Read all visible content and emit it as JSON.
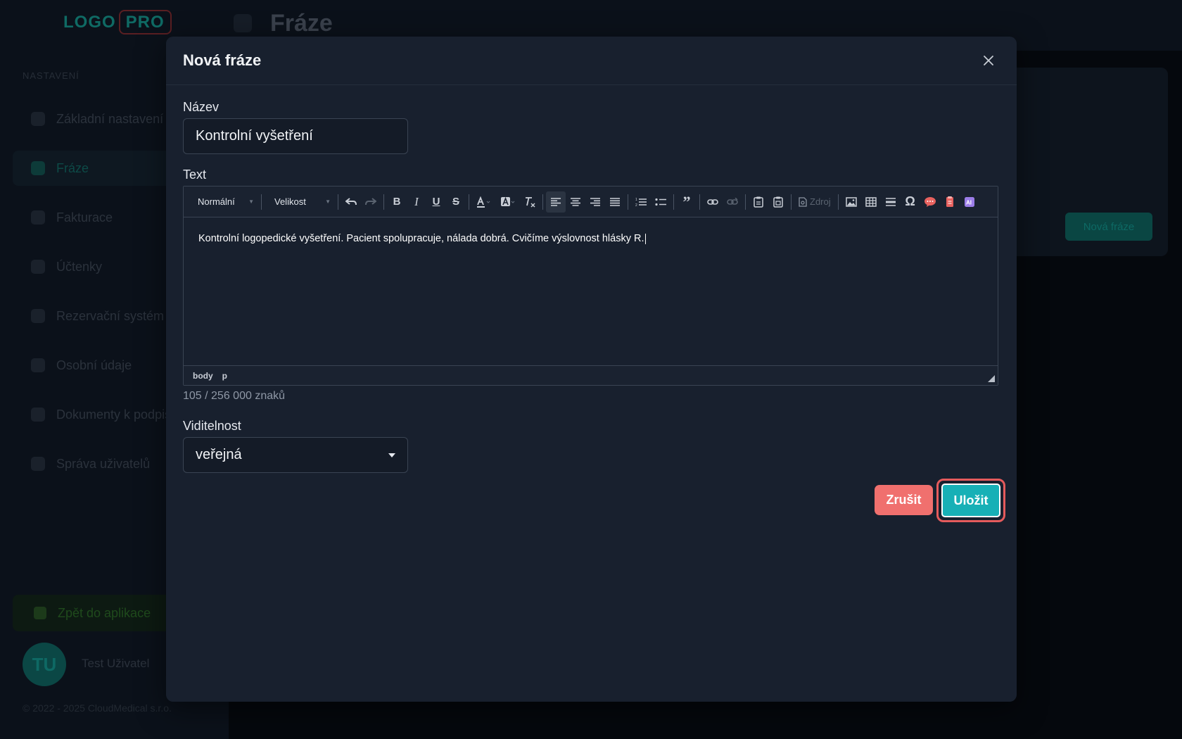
{
  "background": {
    "page_title": "Fráze",
    "logo_part1": "LOGO",
    "logo_part2": "PRO",
    "section_label": "NASTAVENÍ",
    "nav_items": [
      {
        "label": "Základní nastavení"
      },
      {
        "label": "Fráze"
      },
      {
        "label": "Fakturace"
      },
      {
        "label": "Účtenky"
      },
      {
        "label": "Rezervační systém"
      },
      {
        "label": "Osobní údaje"
      },
      {
        "label": "Dokumenty k podpisu"
      },
      {
        "label": "Správa uživatelů"
      }
    ],
    "back_label": "Zpět do aplikace",
    "avatar_initials": "TU",
    "username": "Test Uživatel",
    "copyright": "© 2022 - 2025 CloudMedical s.r.o.",
    "new_button": "Nová fráze"
  },
  "modal": {
    "title": "Nová fráze",
    "name_label": "Název",
    "name_value": "Kontrolní vyšetření",
    "text_label": "Text",
    "toolbar": {
      "format_select": "Normální",
      "size_select": "Velikost",
      "source_label": "Zdroj"
    },
    "editor_content": "Kontrolní logopedické vyšetření. Pacient spolupracuje, nálada dobrá. Cvičíme výslovnost hlásky R.",
    "statusbar": [
      "body",
      "p"
    ],
    "char_count": "105 / 256 000 znaků",
    "visibility_label": "Viditelnost",
    "visibility_value": "veřejná",
    "cancel_label": "Zrušit",
    "save_label": "Uložit"
  },
  "colors": {
    "modal_bg": "#18202e",
    "accent": "#17b0b6",
    "danger": "#f0706e",
    "highlight_ring": "#e55b5c"
  }
}
